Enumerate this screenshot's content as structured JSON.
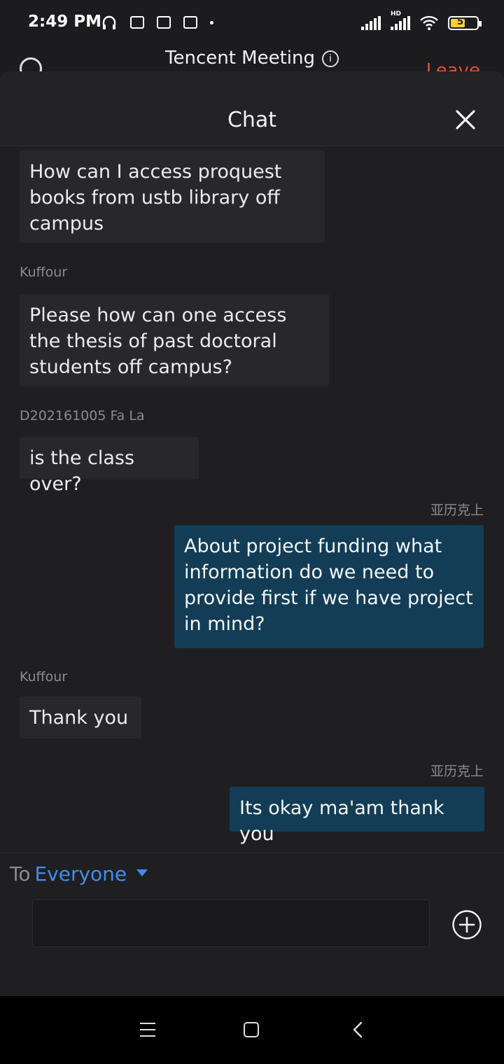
{
  "status_bar": {
    "time": "2:49 PM",
    "battery_percent": "51",
    "network_label": "HD",
    "icons": [
      "headphones-icon",
      "app-icon",
      "app-icon",
      "shield-icon",
      "dot-icon",
      "signal-icon",
      "signal-hd-icon",
      "wifi-icon",
      "battery-icon"
    ]
  },
  "app_bar": {
    "title": "Tencent Meeting",
    "info_glyph": "i",
    "leave_label": "Leave"
  },
  "chat": {
    "title": "Chat",
    "messages": [
      {
        "sender": "",
        "text": "How can I access proquest books from ustb library off campus",
        "mine": false
      },
      {
        "sender": "Kuffour",
        "text": "Please how can one access the thesis of past doctoral students off campus?",
        "mine": false
      },
      {
        "sender": "D202161005 Fa La",
        "text": "is the class over?",
        "mine": false
      },
      {
        "sender": "亚历克上",
        "text": "About project funding what information do we need to provide first if we have project in mind?",
        "mine": true
      },
      {
        "sender": "Kuffour",
        "text": "Thank you",
        "mine": false
      },
      {
        "sender": "亚历克上",
        "text": "Its okay ma'am thank you",
        "mine": true
      }
    ]
  },
  "composer": {
    "to_prefix": "To",
    "to_target": "Everyone",
    "input_value": "",
    "accent_color": "#3f8df0"
  },
  "colors": {
    "my_bubble": "#133c56",
    "other_bubble": "#28282b",
    "leave": "#e24b42"
  }
}
